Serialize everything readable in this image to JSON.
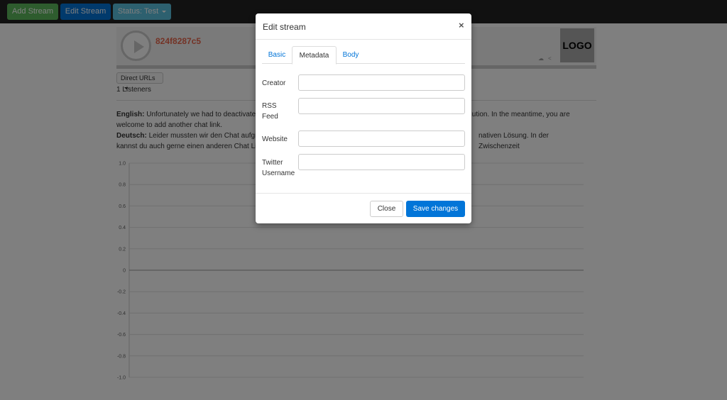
{
  "nav": {
    "add_stream": "Add Stream",
    "edit_stream": "Edit Stream",
    "status": "Status: Test"
  },
  "player": {
    "stream_id": "824f8287c5",
    "logo_text": "LOGO"
  },
  "direct_urls": "Direct URLs",
  "listeners": "1 Listeners",
  "notice": {
    "english_label": "English:",
    "english_text": " Unfortunately we had to deactivate t",
    "english_text_right": " solution. In the meantime, you are",
    "english_text_2": "welcome to add another chat link.",
    "deutsch_label": "Deutsch:",
    "deutsch_text": " Leider mussten wir den Chat aufgru",
    "deutsch_text_right": "nativen Lösung. In der Zwischenzeit",
    "deutsch_text_2": "kannst du auch gerne einen anderen Chat Link"
  },
  "chart_data": {
    "type": "line",
    "ylim": [
      -1.0,
      1.0
    ],
    "yticks": [
      "1.0",
      "0.8",
      "0.6",
      "0.4",
      "0.2",
      "0",
      "-0.2",
      "-0.4",
      "-0.6",
      "-0.8",
      "-1.0"
    ],
    "series": [],
    "grid": true
  },
  "modal": {
    "title": "Edit stream",
    "close_symbol": "×",
    "tabs": [
      "Basic",
      "Metadata",
      "Body"
    ],
    "fields": {
      "creator_label": "Creator",
      "rss_label_1": "RSS",
      "rss_label_2": "Feed",
      "website_label": "Website",
      "twitter_label_1": "Twitter",
      "twitter_label_2": "Username"
    },
    "close_button": "Close",
    "save_button": "Save changes"
  },
  "colors": {
    "add": "#5cb85c",
    "primary": "#0275d8",
    "info": "#5bc0de",
    "stream_id": "#e8674d"
  }
}
